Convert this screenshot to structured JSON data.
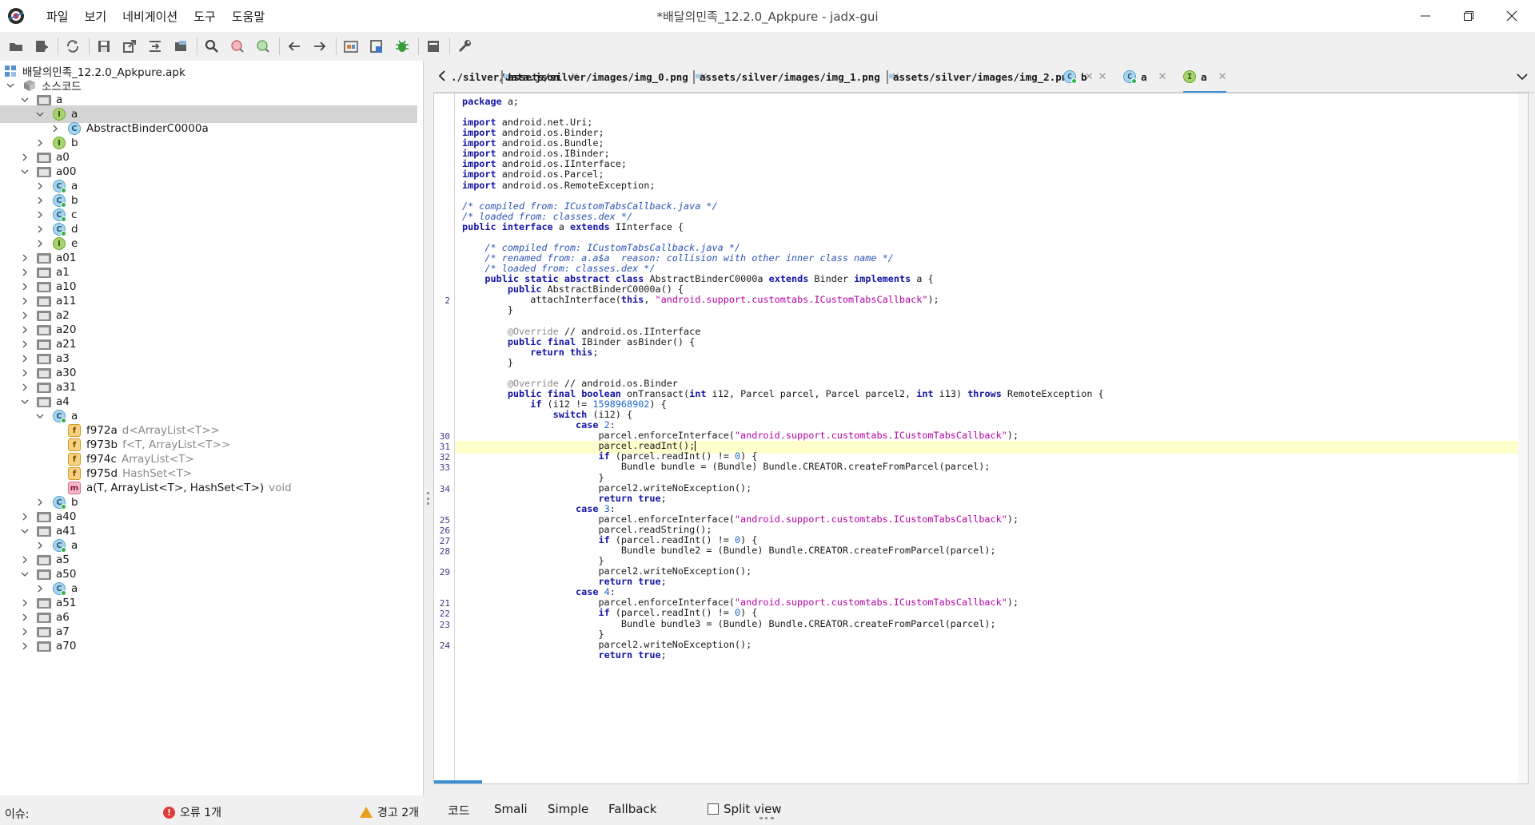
{
  "window": {
    "title": "*배달의민족_12.2.0_Apkpure - jadx-gui",
    "menu": [
      "파일",
      "보기",
      "네비게이션",
      "도구",
      "도움말"
    ]
  },
  "toolbar": {
    "icons": [
      "open-icon",
      "add-files-icon",
      "sync-icon",
      "save-icon",
      "export-icon",
      "sync-tree-icon",
      "flatten-icon",
      "search-icon",
      "class-search-icon",
      "usage-search-icon",
      "back-icon",
      "forward-icon",
      "deobfuscation-icon",
      "log-icon",
      "debug-icon",
      "console-icon",
      "preferences-icon"
    ]
  },
  "tree": {
    "root": "배달의민족_12.2.0_Apkpure.apk",
    "source_node": "소스코드",
    "rows": [
      {
        "label": "a",
        "type": "package",
        "depth": 1,
        "expanded": true
      },
      {
        "label": "a",
        "type": "interface",
        "depth": 2,
        "expanded": true,
        "selected": true
      },
      {
        "label": "AbstractBinderC0000a",
        "type": "class",
        "depth": 3,
        "expanded": false
      },
      {
        "label": "b",
        "type": "interface",
        "depth": 2,
        "expanded": false
      },
      {
        "label": "a0",
        "type": "package",
        "depth": 1,
        "expanded": false
      },
      {
        "label": "a00",
        "type": "package",
        "depth": 1,
        "expanded": true
      },
      {
        "label": "a",
        "type": "class-pub",
        "depth": 2,
        "expanded": false
      },
      {
        "label": "b",
        "type": "class-pub",
        "depth": 2,
        "expanded": false
      },
      {
        "label": "c",
        "type": "class-pub",
        "depth": 2,
        "expanded": false
      },
      {
        "label": "d",
        "type": "class-pub",
        "depth": 2,
        "expanded": false
      },
      {
        "label": "e",
        "type": "interface",
        "depth": 2,
        "expanded": false
      },
      {
        "label": "a01",
        "type": "package",
        "depth": 1,
        "expanded": false
      },
      {
        "label": "a1",
        "type": "package",
        "depth": 1,
        "expanded": false
      },
      {
        "label": "a10",
        "type": "package",
        "depth": 1,
        "expanded": false
      },
      {
        "label": "a11",
        "type": "package",
        "depth": 1,
        "expanded": false
      },
      {
        "label": "a2",
        "type": "package",
        "depth": 1,
        "expanded": false
      },
      {
        "label": "a20",
        "type": "package",
        "depth": 1,
        "expanded": false
      },
      {
        "label": "a21",
        "type": "package",
        "depth": 1,
        "expanded": false
      },
      {
        "label": "a3",
        "type": "package",
        "depth": 1,
        "expanded": false
      },
      {
        "label": "a30",
        "type": "package",
        "depth": 1,
        "expanded": false
      },
      {
        "label": "a31",
        "type": "package",
        "depth": 1,
        "expanded": false
      },
      {
        "label": "a4",
        "type": "package",
        "depth": 1,
        "expanded": true
      },
      {
        "label": "a",
        "type": "class-pub",
        "depth": 2,
        "expanded": true
      },
      {
        "label": "f972a",
        "type": "field",
        "depth": 3,
        "gtype": "d<ArrayList<T>>"
      },
      {
        "label": "f973b",
        "type": "field",
        "depth": 3,
        "gtype": "f<T, ArrayList<T>>"
      },
      {
        "label": "f974c",
        "type": "field",
        "depth": 3,
        "gtype": "ArrayList<T>"
      },
      {
        "label": "f975d",
        "type": "field",
        "depth": 3,
        "gtype": "HashSet<T>"
      },
      {
        "label": "a(T, ArrayList<T>, HashSet<T>)",
        "type": "method",
        "depth": 3,
        "gtype": "void"
      },
      {
        "label": "b",
        "type": "class-pub",
        "depth": 2,
        "expanded": false
      },
      {
        "label": "a40",
        "type": "package",
        "depth": 1,
        "expanded": false
      },
      {
        "label": "a41",
        "type": "package",
        "depth": 1,
        "expanded": true
      },
      {
        "label": "a",
        "type": "class-pub",
        "depth": 2,
        "expanded": false
      },
      {
        "label": "a5",
        "type": "package",
        "depth": 1,
        "expanded": false
      },
      {
        "label": "a50",
        "type": "package",
        "depth": 1,
        "expanded": true
      },
      {
        "label": "a",
        "type": "class-pub",
        "depth": 2,
        "expanded": false
      },
      {
        "label": "a51",
        "type": "package",
        "depth": 1,
        "expanded": false
      },
      {
        "label": "a6",
        "type": "package",
        "depth": 1,
        "expanded": false
      },
      {
        "label": "a7",
        "type": "package",
        "depth": 1,
        "expanded": false
      },
      {
        "label": "a70",
        "type": "package",
        "depth": 1,
        "expanded": false
      }
    ]
  },
  "tabs": [
    {
      "label": "./silver/data.json",
      "icon": "back-arrow-icon",
      "active": false
    },
    {
      "label": "assets/silver/images/img_0.png",
      "icon": "file-icon",
      "active": false
    },
    {
      "label": "assets/silver/images/img_1.png",
      "icon": "file-icon",
      "active": false
    },
    {
      "label": "assets/silver/images/img_2.png",
      "icon": "file-icon",
      "active": false
    },
    {
      "label": "b",
      "icon": "class-icon",
      "active": false
    },
    {
      "label": "a",
      "icon": "class-icon",
      "active": false
    },
    {
      "label": "a",
      "icon": "interface-icon",
      "active": true
    }
  ],
  "code": {
    "highlight_line_index": 33,
    "lines": [
      {
        "n": "",
        "t": "package a;"
      },
      {
        "n": "",
        "t": ""
      },
      {
        "n": "",
        "t": "import android.net.Uri;"
      },
      {
        "n": "",
        "t": "import android.os.Binder;"
      },
      {
        "n": "",
        "t": "import android.os.Bundle;"
      },
      {
        "n": "",
        "t": "import android.os.IBinder;"
      },
      {
        "n": "",
        "t": "import android.os.IInterface;"
      },
      {
        "n": "",
        "t": "import android.os.Parcel;"
      },
      {
        "n": "",
        "t": "import android.os.RemoteException;"
      },
      {
        "n": "",
        "t": ""
      },
      {
        "n": "",
        "t": "/* compiled from: ICustomTabsCallback.java */"
      },
      {
        "n": "",
        "t": "/* loaded from: classes.dex */"
      },
      {
        "n": "",
        "t": "public interface a extends IInterface {"
      },
      {
        "n": "",
        "t": ""
      },
      {
        "n": "",
        "t": "    /* compiled from: ICustomTabsCallback.java */"
      },
      {
        "n": "",
        "t": "    /* renamed from: a.a$a  reason: collision with other inner class name */"
      },
      {
        "n": "",
        "t": "    /* loaded from: classes.dex */"
      },
      {
        "n": "",
        "t": "    public static abstract class AbstractBinderC0000a extends Binder implements a {"
      },
      {
        "n": "",
        "t": "        public AbstractBinderC0000a() {"
      },
      {
        "n": "2",
        "t": "            attachInterface(this, \"android.support.customtabs.ICustomTabsCallback\");"
      },
      {
        "n": "",
        "t": "        }"
      },
      {
        "n": "",
        "t": ""
      },
      {
        "n": "",
        "t": "        @Override // android.os.IInterface"
      },
      {
        "n": "",
        "t": "        public final IBinder asBinder() {"
      },
      {
        "n": "",
        "t": "            return this;"
      },
      {
        "n": "",
        "t": "        }"
      },
      {
        "n": "",
        "t": ""
      },
      {
        "n": "",
        "t": "        @Override // android.os.Binder"
      },
      {
        "n": "",
        "t": "        public final boolean onTransact(int i12, Parcel parcel, Parcel parcel2, int i13) throws RemoteException {"
      },
      {
        "n": "",
        "t": "            if (i12 != 1598968902) {"
      },
      {
        "n": "",
        "t": "                switch (i12) {"
      },
      {
        "n": "",
        "t": "                    case 2:"
      },
      {
        "n": "30",
        "t": "                        parcel.enforceInterface(\"android.support.customtabs.ICustomTabsCallback\");"
      },
      {
        "n": "31",
        "t": "                        parcel.readInt();"
      },
      {
        "n": "32",
        "t": "                        if (parcel.readInt() != 0) {"
      },
      {
        "n": "33",
        "t": "                            Bundle bundle = (Bundle) Bundle.CREATOR.createFromParcel(parcel);"
      },
      {
        "n": "",
        "t": "                        }"
      },
      {
        "n": "34",
        "t": "                        parcel2.writeNoException();"
      },
      {
        "n": "",
        "t": "                        return true;"
      },
      {
        "n": "",
        "t": "                    case 3:"
      },
      {
        "n": "25",
        "t": "                        parcel.enforceInterface(\"android.support.customtabs.ICustomTabsCallback\");"
      },
      {
        "n": "26",
        "t": "                        parcel.readString();"
      },
      {
        "n": "27",
        "t": "                        if (parcel.readInt() != 0) {"
      },
      {
        "n": "28",
        "t": "                            Bundle bundle2 = (Bundle) Bundle.CREATOR.createFromParcel(parcel);"
      },
      {
        "n": "",
        "t": "                        }"
      },
      {
        "n": "29",
        "t": "                        parcel2.writeNoException();"
      },
      {
        "n": "",
        "t": "                        return true;"
      },
      {
        "n": "",
        "t": "                    case 4:"
      },
      {
        "n": "21",
        "t": "                        parcel.enforceInterface(\"android.support.customtabs.ICustomTabsCallback\");"
      },
      {
        "n": "22",
        "t": "                        if (parcel.readInt() != 0) {"
      },
      {
        "n": "23",
        "t": "                            Bundle bundle3 = (Bundle) Bundle.CREATOR.createFromParcel(parcel);"
      },
      {
        "n": "",
        "t": "                        }"
      },
      {
        "n": "24",
        "t": "                        parcel2.writeNoException();"
      },
      {
        "n": "",
        "t": "                        return true;"
      }
    ]
  },
  "statusbar": {
    "issues_label": "이슈:",
    "errors": "오류 1개",
    "warnings": "경고 2개",
    "modes": [
      "코드",
      "Smali",
      "Simple",
      "Fallback"
    ],
    "split_view": "Split view"
  },
  "colors": {
    "keyword": "#1414a8",
    "string": "#b400a6",
    "comment": "#2a55b5",
    "highlight": "#ffffcc",
    "tab_active": "#3c8fd6"
  }
}
